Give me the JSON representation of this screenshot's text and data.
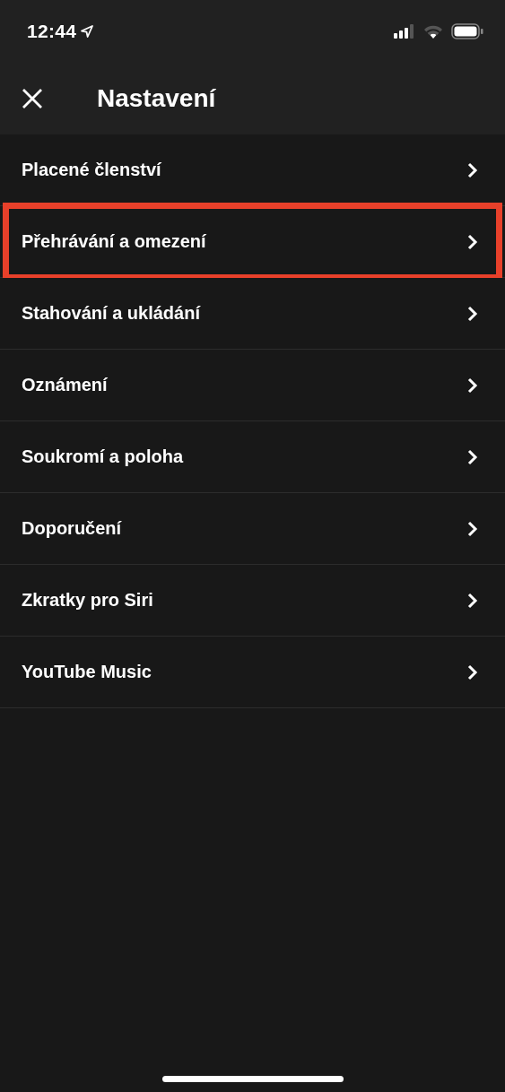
{
  "status_bar": {
    "time": "12:44"
  },
  "header": {
    "title": "Nastavení"
  },
  "items": [
    {
      "label": "Placené členství",
      "highlighted": false
    },
    {
      "label": "Přehrávání a omezení",
      "highlighted": true
    },
    {
      "label": "Stahování a ukládání",
      "highlighted": false
    },
    {
      "label": "Oznámení",
      "highlighted": false
    },
    {
      "label": "Soukromí a poloha",
      "highlighted": false
    },
    {
      "label": "Doporučení",
      "highlighted": false
    },
    {
      "label": "Zkratky pro Siri",
      "highlighted": false
    },
    {
      "label": "YouTube Music",
      "highlighted": false
    }
  ]
}
